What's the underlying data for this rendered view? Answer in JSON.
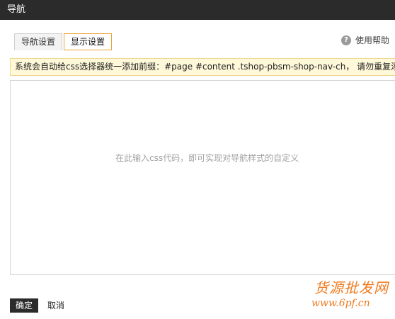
{
  "dialog": {
    "title": "导航"
  },
  "tabs": [
    {
      "label": "导航设置",
      "active": false
    },
    {
      "label": "显示设置",
      "active": true
    }
  ],
  "help": {
    "icon": "question-circle-icon",
    "label": "使用帮助"
  },
  "notice": {
    "text": "系统会自动给css选择器统一添加前缀：#page #content .tshop-pbsm-shop-nav-ch， 请勿重复添加!"
  },
  "editor": {
    "value": "",
    "placeholder": "在此输入css代码，即可实现对导航样式的自定义"
  },
  "footer": {
    "confirm_label": "确定",
    "cancel_label": "取消"
  },
  "watermark": {
    "line1": "货源批发网",
    "line2": "www.6pf.cn"
  },
  "colors": {
    "titlebar": "#2b2b2b",
    "active_tab_border": "#e8a43a",
    "notice_bg": "#fff8d9",
    "watermark": "#f07a1e"
  }
}
